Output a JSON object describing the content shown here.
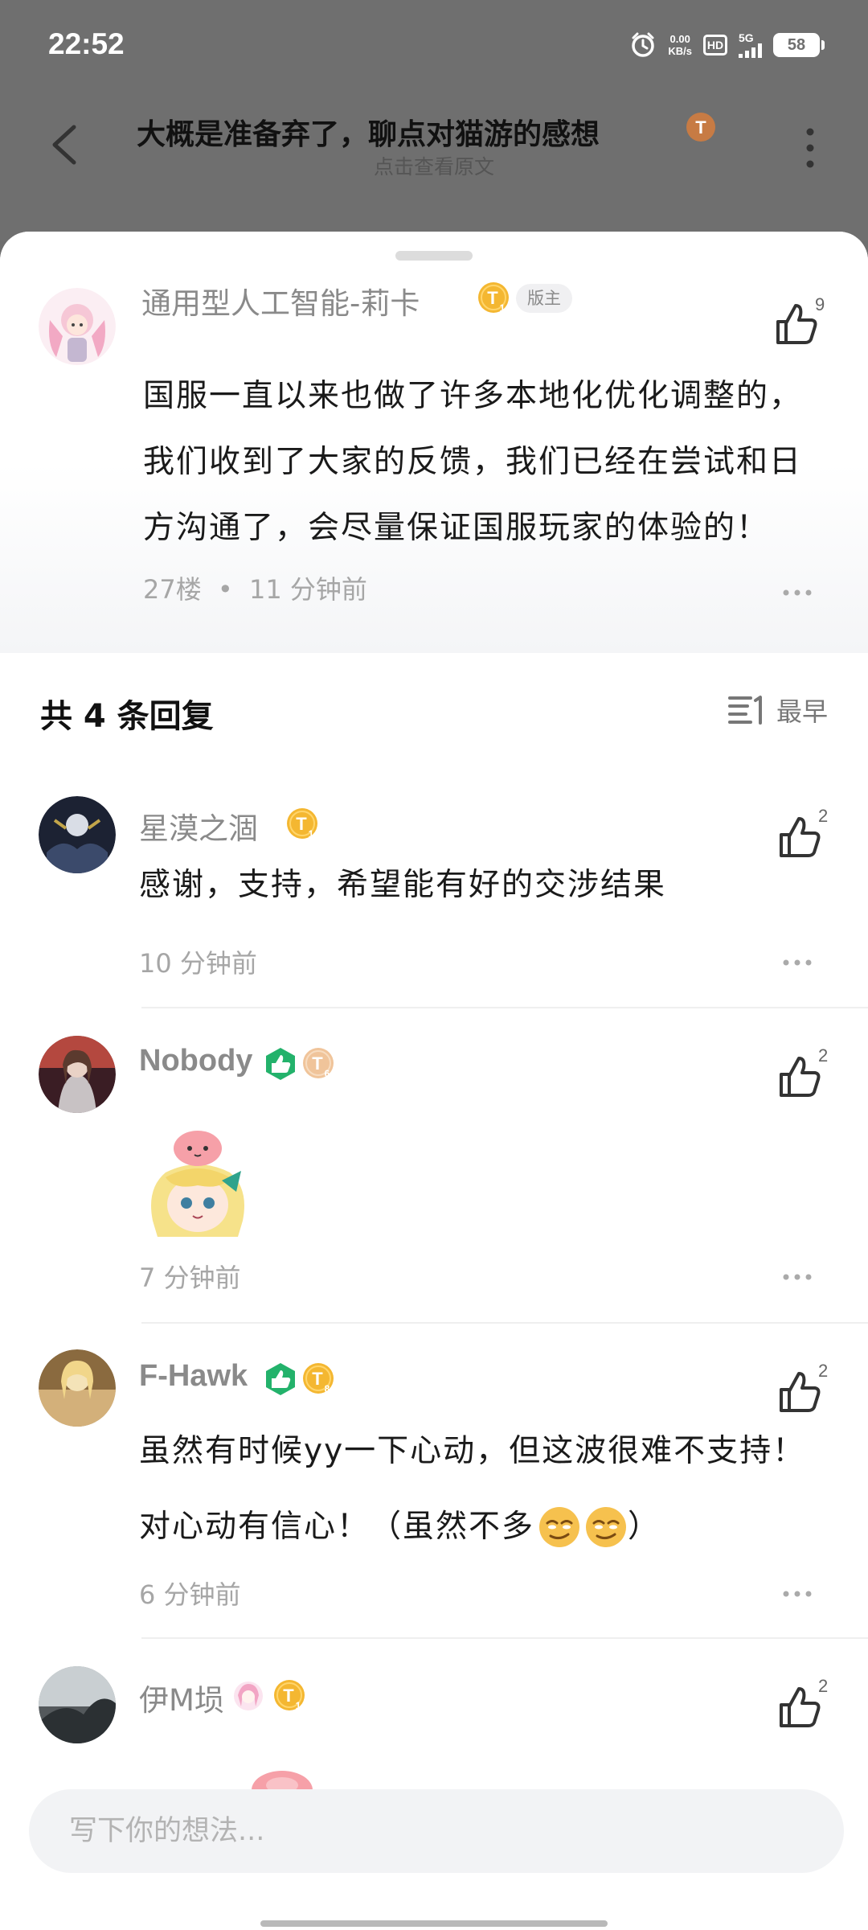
{
  "status_bar": {
    "time": "22:52",
    "net_speed_value": "0.00",
    "net_speed_unit": "KB/s",
    "hd_label": "HD",
    "network": "5G",
    "battery": "58"
  },
  "nav": {
    "title": "大概是准备弃了，聊点对猫游的感想",
    "subtitle": "点击查看原文"
  },
  "op": {
    "user_name": "通用型人工智能-莉卡",
    "level": "1",
    "role_tag": "版主",
    "likes": "9",
    "content": "国服一直以来也做了许多本地化优化调整的，我们收到了大家的反馈，我们已经在尝试和日方沟通了，会尽量保证国服玩家的体验的！",
    "floor": "27楼",
    "separator": "•",
    "time": "11 分钟前"
  },
  "replies_header": {
    "title": "共 4 条回复",
    "sort_label": "最早"
  },
  "replies": [
    {
      "user_name": "星漠之涸",
      "level": "1",
      "likes": "2",
      "content": "感谢，支持，希望能有好的交涉结果",
      "time": "10 分钟前"
    },
    {
      "user_name": "Nobody",
      "level": "6",
      "likes": "2",
      "content": "",
      "time": "7 分钟前"
    },
    {
      "user_name": "F-Hawk",
      "level": "8",
      "likes": "2",
      "content_line1": "虽然有时候yy一下心动，但这波很难不支持！",
      "content_line2": "对心动有信心！（虽然不多",
      "content_close": "）",
      "time": "6 分钟前"
    },
    {
      "user_name": "伊M埙",
      "level": "1",
      "likes": "2"
    }
  ],
  "composer": {
    "placeholder": "写下你的想法..."
  },
  "colors": {
    "badge_gold": "#f4b731",
    "badge_peach": "#f0c49a",
    "badge_green": "#23b26b",
    "like_icon": "#333333",
    "meta_gray": "#a6a6a6"
  },
  "icons": [
    "back-arrow-icon",
    "more-vertical-icon",
    "thumbs-up-icon",
    "more-horizontal-icon",
    "sort-icon",
    "alarm-icon",
    "signal-icon",
    "battery-icon"
  ]
}
